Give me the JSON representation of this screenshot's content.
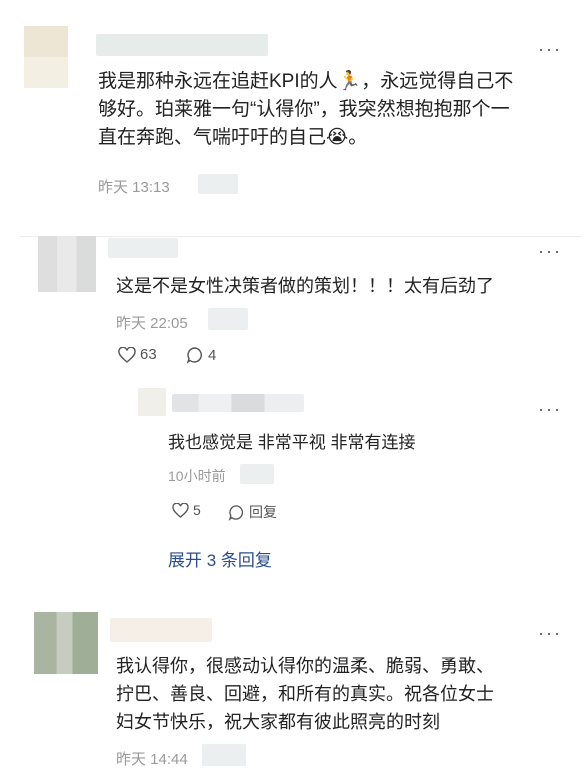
{
  "comments": [
    {
      "text_lines": [
        "我是那种永远在追赶KPI的人🏃，永远觉得自己不",
        "够好。珀莱雅一句“认得你”，我突然想抱抱那个一",
        "直在奔跑、气喘吁吁的自己😭。"
      ],
      "time": "昨天 13:13",
      "more": "···"
    },
    {
      "text_lines": [
        "这是不是女性决策者做的策划！！！太有后劲了"
      ],
      "time": "昨天 22:05",
      "likes": "63",
      "replies": "4",
      "more": "···",
      "reply": {
        "text": "我也感觉是 非常平视 非常有连接",
        "time": "10小时前",
        "likes": "5",
        "reply_label": "回复",
        "more": "···"
      },
      "expand_label": "展开 3 条回复"
    },
    {
      "text_lines": [
        "我认得你，很感动认得你的温柔、脆弱、勇敢、",
        "拧巴、善良、回避，和所有的真实。祝各位女士",
        "妇女节快乐，祝大家都有彼此照亮的时刻"
      ],
      "time": "昨天 14:44",
      "more": "···"
    }
  ],
  "colors": {
    "meta": "#9a9a9a",
    "link": "#2b4e8c",
    "avatar_a": "#e7e2d0",
    "avatar_c": "#a9b79e"
  },
  "icons": [
    "more-icon",
    "heart-icon",
    "comment-icon"
  ]
}
